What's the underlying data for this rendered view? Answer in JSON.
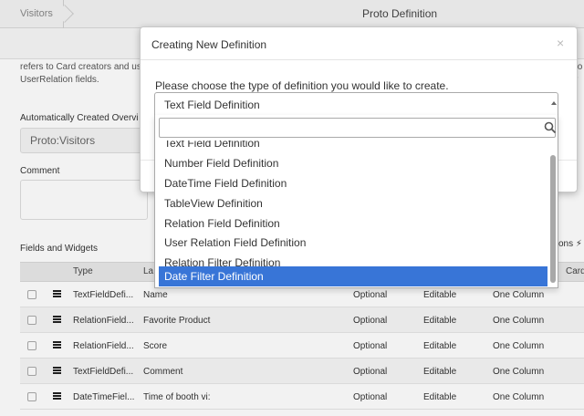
{
  "topbar": {
    "breadcrumb": "Visitors",
    "title": "Proto Definition"
  },
  "form": {
    "description_left": "refers to Card creators and us UserRelation fields.",
    "description_right_frag": "to",
    "description_right_frag2": "r",
    "overview_label": "Automatically Created Overvi",
    "overview_value": "Proto:Visitors",
    "comment_label": "Comment",
    "fields_label": "Fields and Widgets",
    "actions_frag": "ons ⚡"
  },
  "table": {
    "headers": [
      "Type",
      "La",
      "Card"
    ],
    "rows": [
      {
        "type": "TextFieldDefi...",
        "label": "Name",
        "required": "Optional",
        "editable": "Editable",
        "layout": "One Column"
      },
      {
        "type": "RelationField...",
        "label": "Favorite Product",
        "required": "Optional",
        "editable": "Editable",
        "layout": "One Column"
      },
      {
        "type": "RelationField...",
        "label": "Score",
        "required": "Optional",
        "editable": "Editable",
        "layout": "One Column"
      },
      {
        "type": "TextFieldDefi...",
        "label": "Comment",
        "required": "Optional",
        "editable": "Editable",
        "layout": "One Column"
      },
      {
        "type": "DateTimeFiel...",
        "label": "Time of booth vi:",
        "required": "Optional",
        "editable": "Editable",
        "layout": "One Column"
      }
    ]
  },
  "modal": {
    "title": "Creating New Definition",
    "close": "×",
    "prompt": "Please choose the type of definition you would like to create.",
    "selected": "Text Field Definition",
    "search_placeholder": "",
    "options": [
      "Text Field Definition",
      "Number Field Definition",
      "DateTime Field Definition",
      "TableView Definition",
      "Relation Field Definition",
      "User Relation Field Definition",
      "Relation Filter Definition",
      "Date Filter Definition"
    ],
    "highlighted_option": "Date Filter Definition"
  },
  "colors": {
    "highlight": "#3875d7",
    "topbar": "#f3f3f3"
  }
}
